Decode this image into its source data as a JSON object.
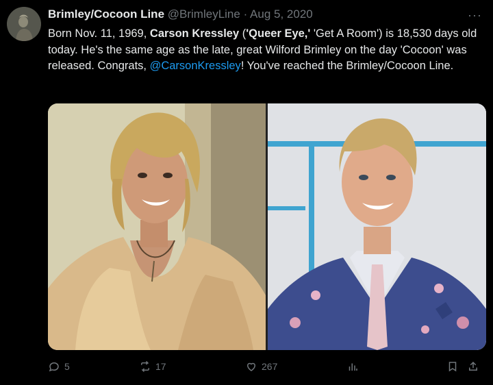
{
  "tweet": {
    "display_name": "Brimley/Cocoon Line",
    "handle": "@BrimleyLine",
    "separator": "·",
    "date": "Aug 5, 2020",
    "more_label": "···",
    "text": {
      "p1": "Born Nov. 11, 1969, ",
      "name_bold": "Carson Kressley",
      "p2": " (",
      "show_bold": "'Queer Eye,'",
      "p3": " 'Get A Room') is 18,530 days old today. He's the same age as the late, great Wilford Brimley on the day 'Cocoon' was released. Congrats, ",
      "mention": "@CarsonKressley",
      "p4": "! You've reached the Brimley/Cocoon Line."
    },
    "media": {
      "left_photo": "Carson Kressley with long blonde hair in a gold shirt",
      "right_photo": "Carson Kressley in a floral blue suit"
    }
  },
  "actions": {
    "replies": "5",
    "reposts": "17",
    "likes": "267",
    "views": ""
  },
  "icons": [
    "reply-icon",
    "repost-icon",
    "like-icon",
    "views-icon",
    "bookmark-icon",
    "share-icon"
  ],
  "colors": {
    "background": "#000000",
    "text": "#e7e9ea",
    "muted": "#71767b",
    "link": "#1d9bf0"
  }
}
